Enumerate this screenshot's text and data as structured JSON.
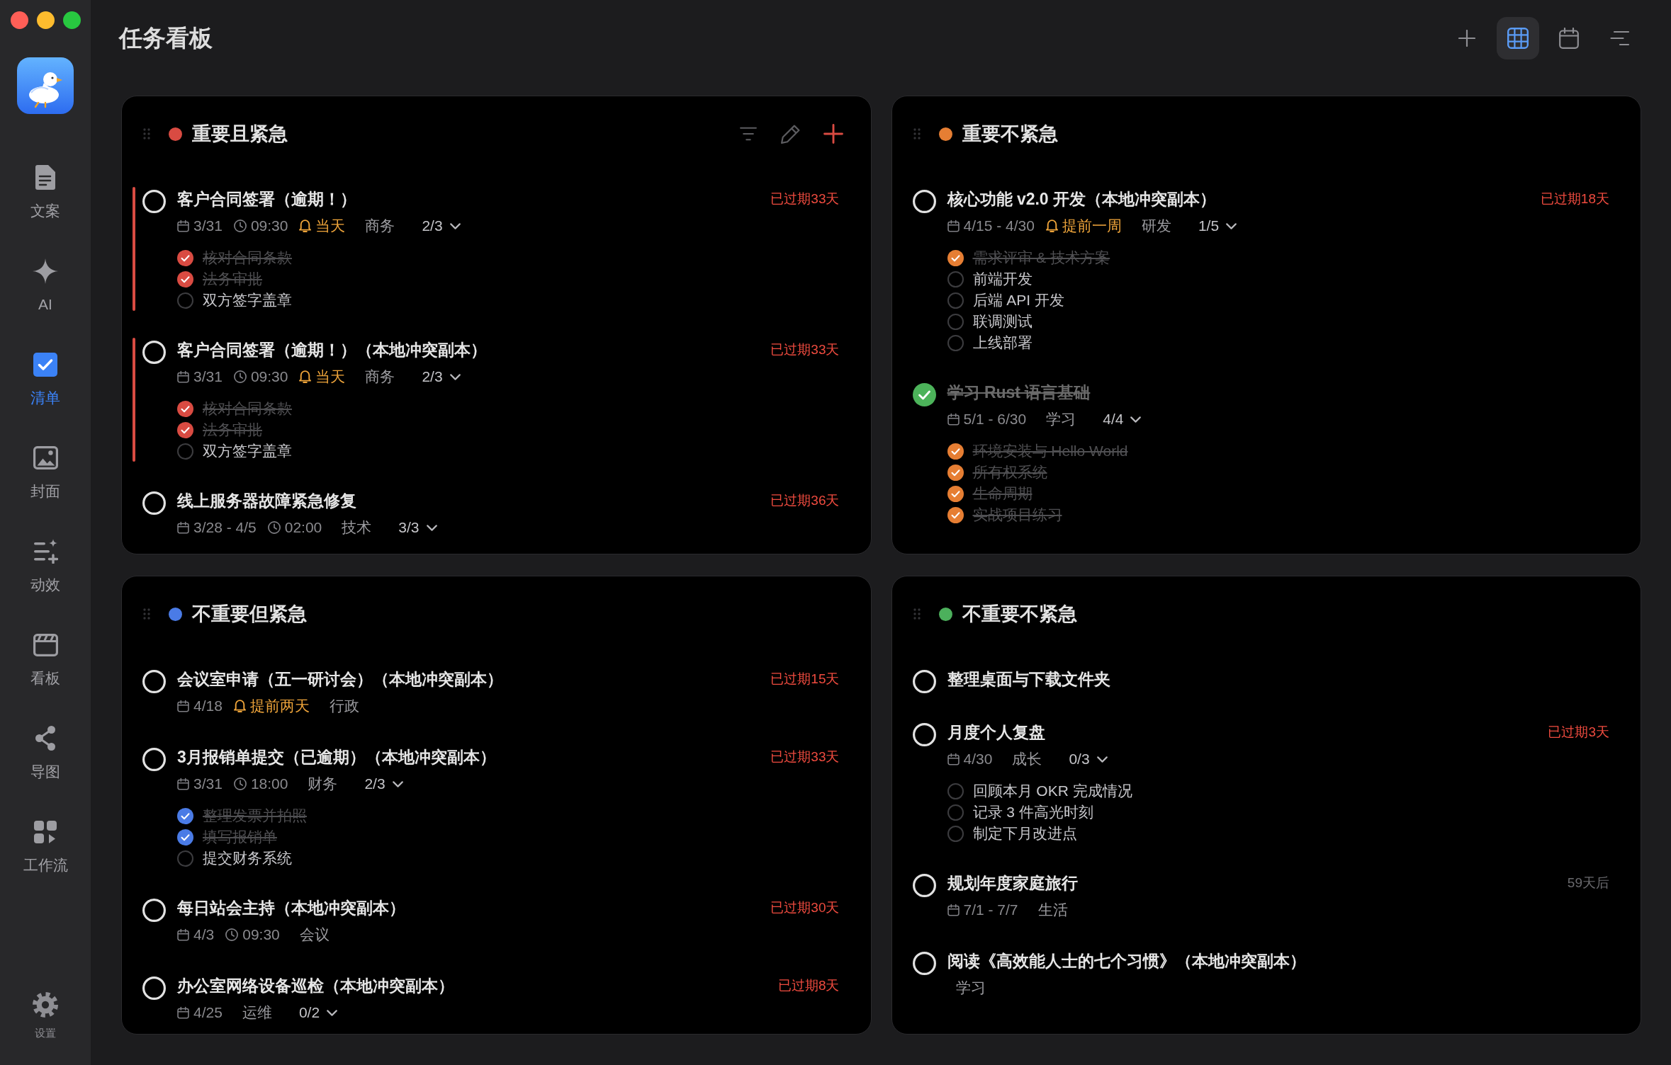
{
  "sidebar": {
    "items": [
      {
        "label": "文案",
        "kind": "document",
        "selected": false
      },
      {
        "label": "AI",
        "kind": "sparkle",
        "selected": false
      },
      {
        "label": "清单",
        "kind": "checklist",
        "selected": true
      },
      {
        "label": "封面",
        "kind": "image",
        "selected": false
      },
      {
        "label": "动效",
        "kind": "effects",
        "selected": false
      },
      {
        "label": "看板",
        "kind": "board",
        "selected": false
      },
      {
        "label": "导图",
        "kind": "mindmap",
        "selected": false
      },
      {
        "label": "工作流",
        "kind": "workflow",
        "selected": false
      }
    ],
    "settings": {
      "label": "设置"
    }
  },
  "header": {
    "title": "任务看板",
    "tools": [
      {
        "kind": "add",
        "selected": false
      },
      {
        "kind": "grid",
        "selected": true
      },
      {
        "kind": "calendar",
        "selected": false
      },
      {
        "kind": "sort",
        "selected": false
      }
    ]
  },
  "quadrants": [
    {
      "title": "重要且紧急",
      "color": "#d94b42",
      "show_actions": true,
      "tasks": [
        {
          "title": "客户合同签署（逾期！）",
          "done": false,
          "highlighted": true,
          "due": {
            "text": "已过期33天",
            "overdue": true
          },
          "meta": [
            {
              "kind": "date",
              "text": "3/31"
            },
            {
              "kind": "time",
              "text": "09:30"
            },
            {
              "kind": "reminder",
              "text": "当天"
            },
            {
              "kind": "tag",
              "text": "商务"
            },
            {
              "kind": "progress",
              "text": "2/3"
            }
          ],
          "subtasks": [
            {
              "text": "核对合同条款",
              "checked": true
            },
            {
              "text": "法务审批",
              "checked": true
            },
            {
              "text": "双方签字盖章",
              "checked": false
            }
          ]
        },
        {
          "title": "客户合同签署（逾期！）（本地冲突副本）",
          "done": false,
          "highlighted": true,
          "due": {
            "text": "已过期33天",
            "overdue": true
          },
          "meta": [
            {
              "kind": "date",
              "text": "3/31"
            },
            {
              "kind": "time",
              "text": "09:30"
            },
            {
              "kind": "reminder",
              "text": "当天"
            },
            {
              "kind": "tag",
              "text": "商务"
            },
            {
              "kind": "progress",
              "text": "2/3"
            }
          ],
          "subtasks": [
            {
              "text": "核对合同条款",
              "checked": true
            },
            {
              "text": "法务审批",
              "checked": true
            },
            {
              "text": "双方签字盖章",
              "checked": false
            }
          ]
        },
        {
          "title": "线上服务器故障紧急修复",
          "done": false,
          "highlighted": false,
          "due": {
            "text": "已过期36天",
            "overdue": true
          },
          "meta": [
            {
              "kind": "date",
              "text": "3/28 - 4/5"
            },
            {
              "kind": "time",
              "text": "02:00"
            },
            {
              "kind": "tag",
              "text": "技术"
            },
            {
              "kind": "progress",
              "text": "3/3"
            }
          ]
        }
      ]
    },
    {
      "title": "重要不紧急",
      "color": "#e67e33",
      "show_actions": false,
      "tasks": [
        {
          "title": "核心功能 v2.0 开发（本地冲突副本）",
          "done": false,
          "highlighted": false,
          "due": {
            "text": "已过期18天",
            "overdue": true
          },
          "meta": [
            {
              "kind": "date",
              "text": "4/15 - 4/30"
            },
            {
              "kind": "reminder",
              "text": "提前一周"
            },
            {
              "kind": "tag",
              "text": "研发"
            },
            {
              "kind": "progress",
              "text": "1/5"
            }
          ],
          "subtasks": [
            {
              "text": "需求评审 & 技术方案",
              "checked": true
            },
            {
              "text": "前端开发",
              "checked": false
            },
            {
              "text": "后端 API 开发",
              "checked": false
            },
            {
              "text": "联调测试",
              "checked": false
            },
            {
              "text": "上线部署",
              "checked": false
            }
          ]
        },
        {
          "title": "学习 Rust 语言基础",
          "done": true,
          "highlighted": false,
          "meta": [
            {
              "kind": "date",
              "text": "5/1 - 6/30"
            },
            {
              "kind": "tag",
              "text": "学习"
            },
            {
              "kind": "progress",
              "text": "4/4"
            }
          ],
          "subtasks": [
            {
              "text": "环境安装与 Hello World",
              "checked": true
            },
            {
              "text": "所有权系统",
              "checked": true
            },
            {
              "text": "生命周期",
              "checked": true
            },
            {
              "text": "实战项目练习",
              "checked": true
            }
          ]
        }
      ]
    },
    {
      "title": "不重要但紧急",
      "color": "#4a7be6",
      "show_actions": false,
      "tasks": [
        {
          "title": "会议室申请（五一研讨会）（本地冲突副本）",
          "done": false,
          "highlighted": false,
          "due": {
            "text": "已过期15天",
            "overdue": true
          },
          "meta": [
            {
              "kind": "date",
              "text": "4/18"
            },
            {
              "kind": "reminder",
              "text": "提前两天"
            },
            {
              "kind": "tag",
              "text": "行政"
            }
          ]
        },
        {
          "title": "3月报销单提交（已逾期）（本地冲突副本）",
          "done": false,
          "highlighted": false,
          "due": {
            "text": "已过期33天",
            "overdue": true
          },
          "meta": [
            {
              "kind": "date",
              "text": "3/31"
            },
            {
              "kind": "time",
              "text": "18:00"
            },
            {
              "kind": "tag",
              "text": "财务"
            },
            {
              "kind": "progress",
              "text": "2/3"
            }
          ],
          "subtasks": [
            {
              "text": "整理发票并拍照",
              "checked": true
            },
            {
              "text": "填写报销单",
              "checked": true
            },
            {
              "text": "提交财务系统",
              "checked": false
            }
          ]
        },
        {
          "title": "每日站会主持（本地冲突副本）",
          "done": false,
          "highlighted": false,
          "due": {
            "text": "已过期30天",
            "overdue": true
          },
          "meta": [
            {
              "kind": "date",
              "text": "4/3"
            },
            {
              "kind": "time",
              "text": "09:30"
            },
            {
              "kind": "tag",
              "text": "会议"
            }
          ]
        },
        {
          "title": "办公室网络设备巡检（本地冲突副本）",
          "done": false,
          "highlighted": false,
          "due": {
            "text": "已过期8天",
            "overdue": true
          },
          "meta": [
            {
              "kind": "date",
              "text": "4/25"
            },
            {
              "kind": "tag",
              "text": "运维"
            },
            {
              "kind": "progress",
              "text": "0/2"
            }
          ]
        }
      ]
    },
    {
      "title": "不重要不紧急",
      "color": "#4cb05c",
      "show_actions": false,
      "tasks": [
        {
          "title": "整理桌面与下载文件夹",
          "done": false,
          "highlighted": false
        },
        {
          "title": "月度个人复盘",
          "done": false,
          "highlighted": false,
          "due": {
            "text": "已过期3天",
            "overdue": true
          },
          "meta": [
            {
              "kind": "date",
              "text": "4/30"
            },
            {
              "kind": "tag",
              "text": "成长"
            },
            {
              "kind": "progress",
              "text": "0/3"
            }
          ],
          "subtasks": [
            {
              "text": "回顾本月 OKR 完成情况",
              "checked": false
            },
            {
              "text": "记录 3 件高光时刻",
              "checked": false
            },
            {
              "text": "制定下月改进点",
              "checked": false
            }
          ]
        },
        {
          "title": "规划年度家庭旅行",
          "done": false,
          "highlighted": false,
          "due": {
            "text": "59天后",
            "overdue": false
          },
          "meta": [
            {
              "kind": "date",
              "text": "7/1 - 7/7"
            },
            {
              "kind": "tag",
              "text": "生活"
            }
          ]
        },
        {
          "title": "阅读《高效能人士的七个习惯》（本地冲突副本）",
          "done": false,
          "highlighted": false,
          "meta": [
            {
              "kind": "tag",
              "text": "学习"
            }
          ]
        }
      ]
    }
  ]
}
